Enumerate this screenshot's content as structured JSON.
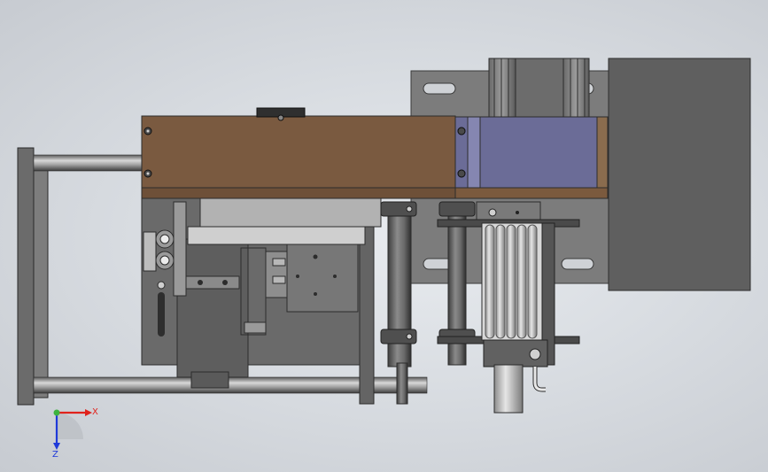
{
  "view": {
    "triad": {
      "x_label": "X",
      "z_label": "Z",
      "x_color": "#e0221c",
      "y_color": "#3db33d",
      "z_color": "#1f3ad9"
    }
  },
  "colors": {
    "body_brown": "#7a5a40",
    "panel_blue": "#6e6e9a",
    "metal_dark": "#595959",
    "metal_mid": "#7b7b7b",
    "metal_light": "#b5b5b5",
    "rod": "#a9a9a9",
    "rod_shadow": "#3e3e3e"
  }
}
